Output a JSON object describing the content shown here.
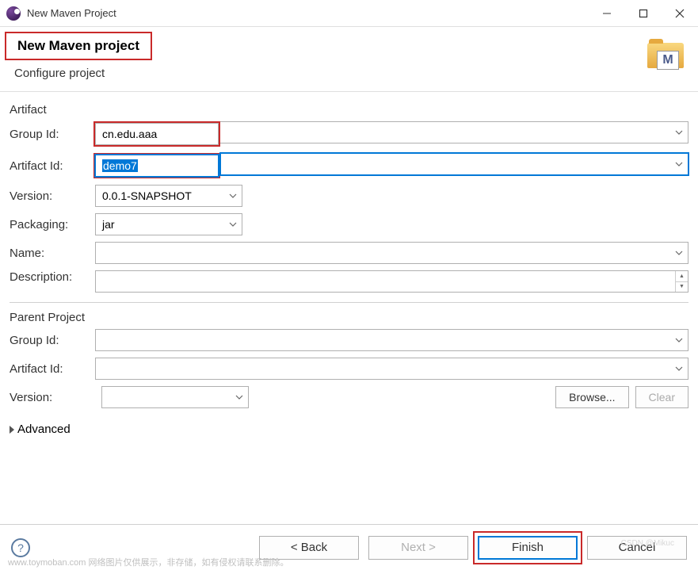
{
  "titlebar": {
    "title": "New Maven Project"
  },
  "header": {
    "title": "New Maven project",
    "subtitle": "Configure project",
    "icon_letter": "M"
  },
  "artifact": {
    "section_label": "Artifact",
    "group_id": {
      "label": "Group Id:",
      "value": "cn.edu.aaa"
    },
    "artifact_id": {
      "label": "Artifact Id:",
      "value": "demo7"
    },
    "version": {
      "label": "Version:",
      "value": "0.0.1-SNAPSHOT"
    },
    "packaging": {
      "label": "Packaging:",
      "value": "jar"
    },
    "name": {
      "label": "Name:",
      "value": ""
    },
    "description": {
      "label": "Description:",
      "value": ""
    }
  },
  "parent": {
    "section_label": "Parent Project",
    "group_id": {
      "label": "Group Id:",
      "value": ""
    },
    "artifact_id": {
      "label": "Artifact Id:",
      "value": ""
    },
    "version": {
      "label": "Version:",
      "value": ""
    },
    "browse_label": "Browse...",
    "clear_label": "Clear"
  },
  "advanced": {
    "label": "Advanced"
  },
  "footer": {
    "back": "< Back",
    "next": "Next >",
    "finish": "Finish",
    "cancel": "Cancel"
  },
  "watermark": "www.toymoban.com 网络图片仅供展示，非存储，如有侵权请联系删除。",
  "watermark2": "CSDN @Mikuc"
}
